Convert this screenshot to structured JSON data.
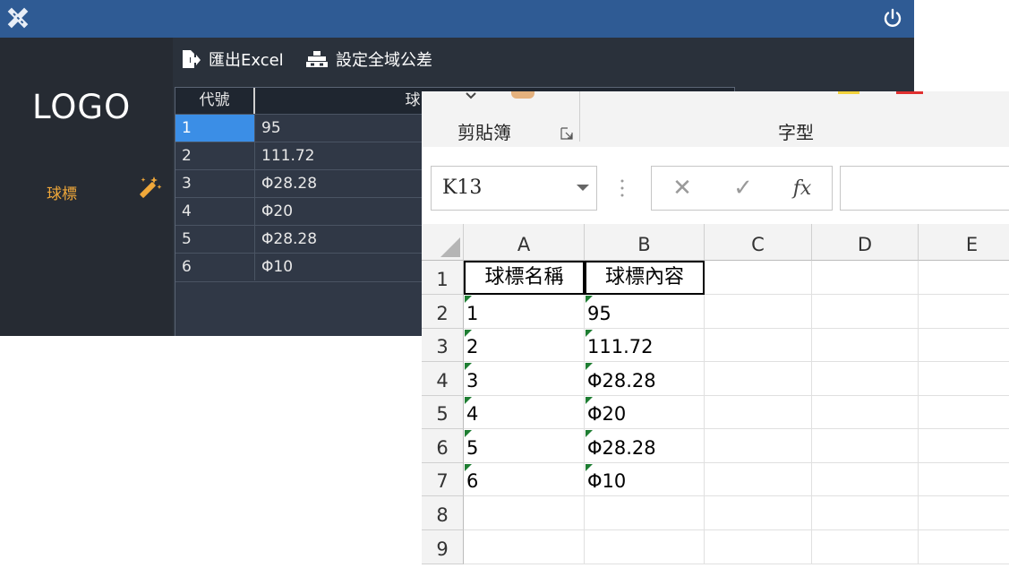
{
  "app": {
    "logo": "LOGO",
    "nav": {
      "item_label": "球標"
    },
    "toolbar": {
      "export_label": "匯出Excel",
      "tolerance_label": "設定全域公差"
    },
    "grid": {
      "headers": [
        "代號",
        "球"
      ],
      "rows": [
        {
          "id": "1",
          "value": "95"
        },
        {
          "id": "2",
          "value": "111.72"
        },
        {
          "id": "3",
          "value": "Φ28.28"
        },
        {
          "id": "4",
          "value": "Φ20"
        },
        {
          "id": "5",
          "value": "Φ28.28"
        },
        {
          "id": "6",
          "value": "Φ10"
        }
      ]
    },
    "icons": [
      "app-logo-icon",
      "power-icon",
      "magic-wand-icon",
      "export-excel-icon",
      "tolerance-icon"
    ],
    "colors": {
      "titlebar": "#2f5b94",
      "accent": "#f0a83a",
      "selection": "#3b8ee6"
    }
  },
  "excel": {
    "ribbon": {
      "clipboard_label": "剪貼簿",
      "font_label": "字型"
    },
    "formula_bar": {
      "name_box": "K13",
      "cancel_icon": "✕",
      "enter_icon": "✓",
      "fx_label": "fx",
      "formula": ""
    },
    "columns": [
      "A",
      "B",
      "C",
      "D",
      "E"
    ],
    "row_numbers": [
      "1",
      "2",
      "3",
      "4",
      "5",
      "6",
      "7",
      "8",
      "9"
    ],
    "rows": [
      [
        "球標名稱",
        "球標內容"
      ],
      [
        "1",
        "95"
      ],
      [
        "2",
        "111.72"
      ],
      [
        "3",
        "Φ28.28"
      ],
      [
        "4",
        "Φ20"
      ],
      [
        "5",
        "Φ28.28"
      ],
      [
        "6",
        "Φ10"
      ],
      [
        "",
        ""
      ],
      [
        "",
        ""
      ]
    ]
  }
}
